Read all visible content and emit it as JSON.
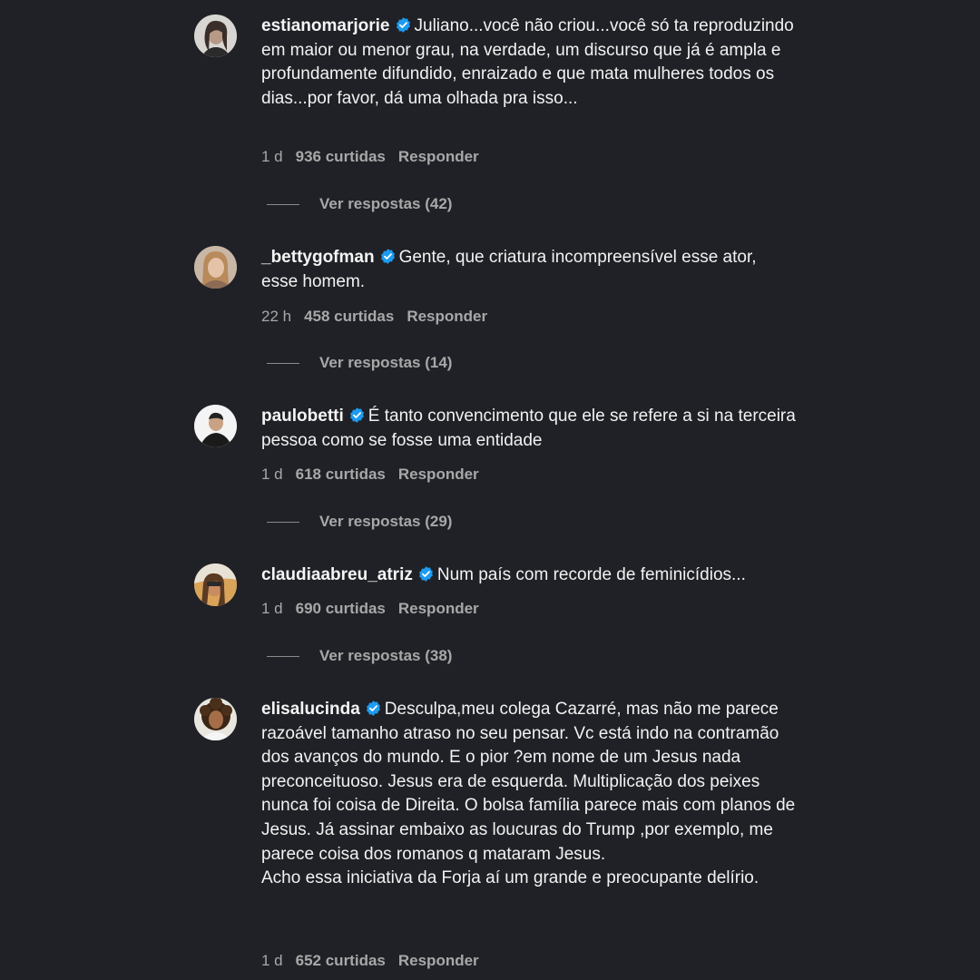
{
  "comments": [
    {
      "username": "estianomarjorie",
      "text": "Juliano...você não criou...você só ta reproduzindo em maior ou menor grau, na verdade, um discurso que já é ampla e profundamente difundido, enraizado e que mata mulheres todos os dias...por favor, dá uma olhada pra isso...",
      "time": "1 d",
      "likes": "936 curtidas",
      "reply": "Responder",
      "view_replies": "Ver respostas (42)"
    },
    {
      "username": "_bettygofman",
      "text": "Gente, que criatura incompreensível esse ator, esse homem.",
      "time": "22 h",
      "likes": "458 curtidas",
      "reply": "Responder",
      "view_replies": "Ver respostas (14)"
    },
    {
      "username": "paulobetti",
      "text": "É tanto convencimento que ele se refere a si na terceira pessoa como se fosse uma entidade",
      "time": "1 d",
      "likes": "618 curtidas",
      "reply": "Responder",
      "view_replies": "Ver respostas (29)"
    },
    {
      "username": "claudiaabreu_atriz",
      "text": "Num país com recorde de feminicídios...",
      "time": "1 d",
      "likes": "690 curtidas",
      "reply": "Responder",
      "view_replies": "Ver respostas (38)"
    },
    {
      "username": "elisalucinda",
      "text": "Desculpa,meu colega Cazarré, mas não me parece razoável tamanho atraso no seu pensar. Vc está indo na contramão dos avanços do mundo. E o pior ?em nome de um Jesus nada preconceituoso. Jesus era de esquerda. Multiplicação dos peixes nunca foi coisa de Direita. O bolsa família parece mais com planos de Jesus. Já assinar embaixo as loucuras do Trump ,por exemplo, me parece coisa dos romanos q mataram Jesus.\nAcho essa iniciativa da Forja aí um grande e preocupante delírio.",
      "time": "1 d",
      "likes": "652 curtidas",
      "reply": "Responder"
    }
  ],
  "icons": {
    "verified": "verified-badge-icon",
    "avatar": "avatar"
  },
  "colors": {
    "background": "#1f2126",
    "verified": "#1d9bf0",
    "secondary_text": "#a8a8a8"
  }
}
